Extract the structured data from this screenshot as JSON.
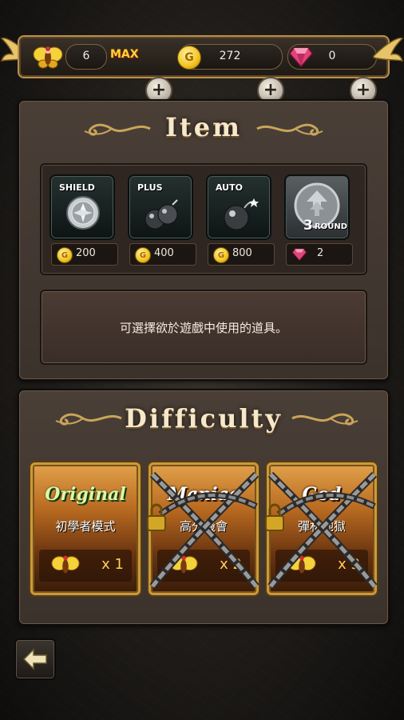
{
  "topbar": {
    "lives": "6",
    "lives_max": "MAX",
    "gold": "272",
    "gems": "0",
    "coin_symbol": "G"
  },
  "item_panel": {
    "title": "Item",
    "items": [
      {
        "label": "SHIELD",
        "price": "200",
        "currency": "gold"
      },
      {
        "label": "PLUS",
        "price": "400",
        "currency": "gold"
      },
      {
        "label": "AUTO",
        "price": "800",
        "currency": "gold"
      },
      {
        "label": "3",
        "label_suffix": "ROUND",
        "price": "2",
        "currency": "gem"
      }
    ],
    "description": "可選擇欲於遊戲中使用的道具。"
  },
  "difficulty_panel": {
    "title": "Difficulty",
    "modes": [
      {
        "name": "Original",
        "subtitle": "初學者模式",
        "cost": "x 1",
        "locked": false
      },
      {
        "name": "Maniac",
        "subtitle": "高分機會",
        "cost": "x 2",
        "locked": true
      },
      {
        "name": "God",
        "subtitle": "彈林地獄",
        "cost": "x 3",
        "locked": true
      }
    ]
  },
  "colors": {
    "gold_trim": "#c89a3c",
    "panel_bg": "#4a3f37",
    "accent_gem": "#e0457a"
  }
}
